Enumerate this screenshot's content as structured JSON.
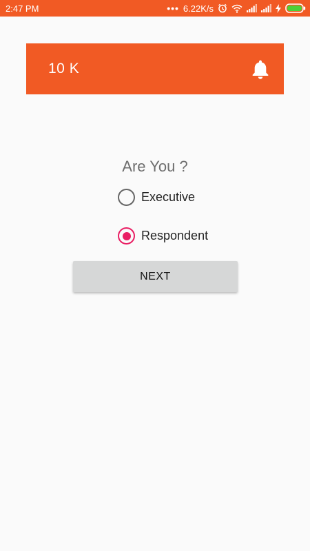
{
  "status_bar": {
    "time": "2:47 PM",
    "network_speed": "6.22K/s",
    "icons": [
      "more-dots-icon",
      "alarm-icon",
      "wifi-icon",
      "signal-icon",
      "signal-icon",
      "charging-icon",
      "battery-icon"
    ]
  },
  "app_bar": {
    "count": "10 K",
    "icon": "bell-icon"
  },
  "form": {
    "question": "Are You ?",
    "options": [
      {
        "label": "Executive",
        "checked": false
      },
      {
        "label": "Respondent",
        "checked": true
      }
    ],
    "next_label": "NEXT"
  },
  "colors": {
    "primary": "#f15a24",
    "accent": "#e91e63",
    "background": "#fafafa",
    "button": "#d6d7d7"
  }
}
